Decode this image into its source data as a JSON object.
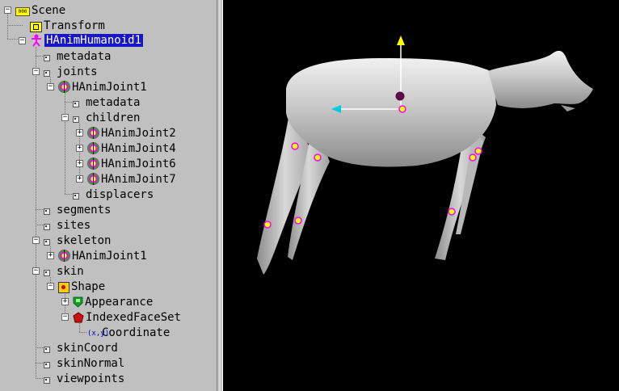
{
  "tree": {
    "nodes": [
      {
        "label": "Scene",
        "icon": "scene-icon",
        "toggle": "-"
      },
      {
        "label": "Transform",
        "icon": "transform-icon"
      },
      {
        "label": "HAnimHumanoid1",
        "icon": "humanoid-icon",
        "toggle": "-",
        "selected": true
      },
      {
        "label": "metadata",
        "icon": "field-icon"
      },
      {
        "label": "joints",
        "icon": "field-icon",
        "toggle": "-"
      },
      {
        "label": "HAnimJoint1",
        "icon": "joint-icon",
        "toggle": "-"
      },
      {
        "label": "metadata",
        "icon": "field-icon"
      },
      {
        "label": "children",
        "icon": "field-icon",
        "toggle": "-"
      },
      {
        "label": "HAnimJoint2",
        "icon": "joint-icon",
        "toggle": "+"
      },
      {
        "label": "HAnimJoint4",
        "icon": "joint-icon",
        "toggle": "+"
      },
      {
        "label": "HAnimJoint6",
        "icon": "joint-icon",
        "toggle": "+"
      },
      {
        "label": "HAnimJoint7",
        "icon": "joint-icon",
        "toggle": "+"
      },
      {
        "label": "displacers",
        "icon": "field-icon"
      },
      {
        "label": "segments",
        "icon": "field-icon"
      },
      {
        "label": "sites",
        "icon": "field-icon"
      },
      {
        "label": "skeleton",
        "icon": "field-icon",
        "toggle": "-"
      },
      {
        "label": "HAnimJoint1",
        "icon": "joint-icon",
        "toggle": "+"
      },
      {
        "label": "skin",
        "icon": "field-icon",
        "toggle": "-"
      },
      {
        "label": "Shape",
        "icon": "shape-icon",
        "toggle": "-"
      },
      {
        "label": "Appearance",
        "icon": "appearance-icon",
        "toggle": "+"
      },
      {
        "label": "IndexedFaceSet",
        "icon": "indexedfaceset-icon",
        "toggle": "-"
      },
      {
        "label": "Coordinate",
        "icon": "coordinate-icon"
      },
      {
        "label": "skinCoord",
        "icon": "field-icon"
      },
      {
        "label": "skinNormal",
        "icon": "field-icon"
      },
      {
        "label": "viewpoints",
        "icon": "field-icon"
      }
    ]
  },
  "icons": {
    "scene_text": "000",
    "coord_text": "(x,y)"
  },
  "colors": {
    "selection": "#1717c6",
    "panel_bg": "#c0c0c0",
    "viewport_bg": "#000000",
    "model": "#c8c8c8"
  }
}
